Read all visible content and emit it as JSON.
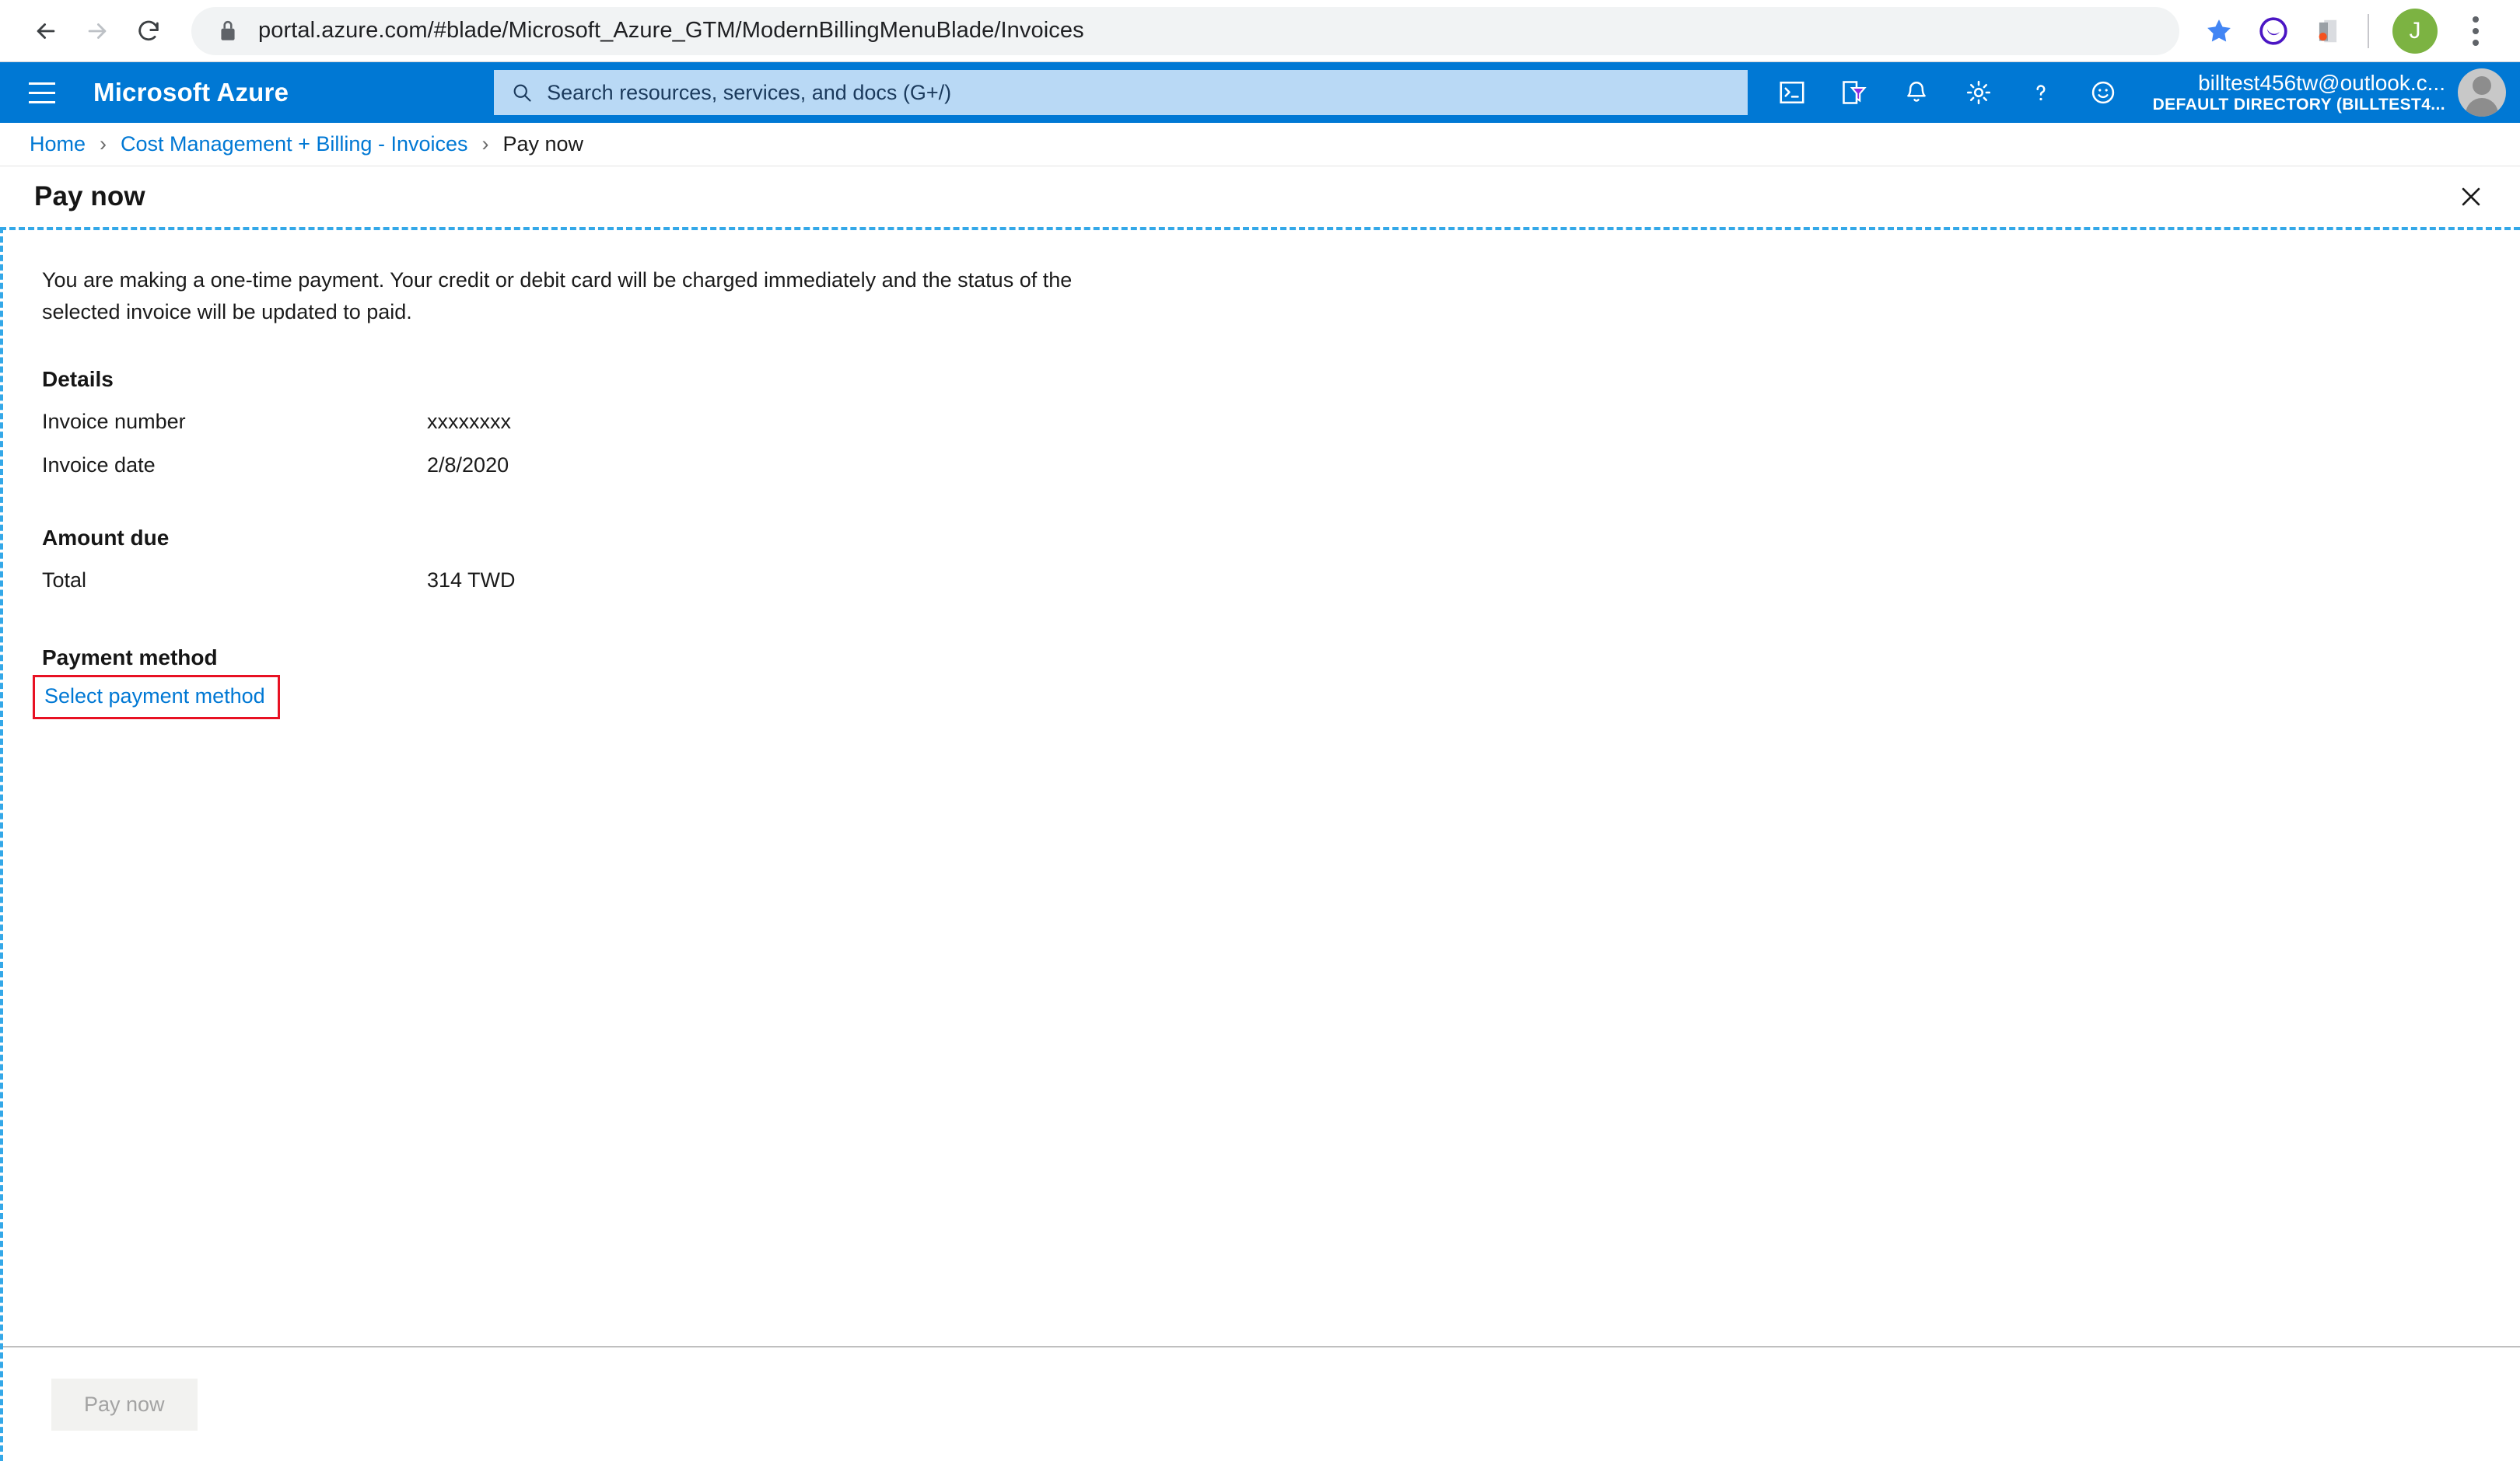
{
  "browser": {
    "back_icon": "back-arrow-icon",
    "forward_icon": "forward-arrow-icon",
    "reload_icon": "reload-icon",
    "lock_icon": "lock-icon",
    "url": "portal.azure.com/#blade/Microsoft_Azure_GTM/ModernBillingMenuBlade/Invoices",
    "bookmark_icon": "star-icon",
    "extension_purple_icon": "purple-circle-extension-icon",
    "extension_doc_icon": "document-extension-icon",
    "profile_initial": "J",
    "menu_icon": "kebab-menu-icon"
  },
  "azure_header": {
    "menu_icon": "hamburger-menu-icon",
    "brand": "Microsoft Azure",
    "search_placeholder": "Search resources, services, and docs (G+/)",
    "search_icon": "search-icon",
    "icons": [
      {
        "name": "cloud-shell-icon",
        "glyph": ">_"
      },
      {
        "name": "directory-filter-icon",
        "glyph": "filter"
      },
      {
        "name": "notifications-bell-icon",
        "glyph": "bell"
      },
      {
        "name": "settings-gear-icon",
        "glyph": "gear"
      },
      {
        "name": "help-icon",
        "glyph": "?"
      },
      {
        "name": "feedback-smiley-icon",
        "glyph": "smiley"
      }
    ],
    "account_name": "billtest456tw@outlook.c...",
    "account_directory": "DEFAULT DIRECTORY (BILLTEST4...",
    "avatar_icon": "user-avatar-icon"
  },
  "breadcrumb": {
    "items": [
      {
        "label": "Home",
        "current": false
      },
      {
        "label": "Cost Management + Billing - Invoices",
        "current": false
      },
      {
        "label": "Pay now",
        "current": true
      }
    ],
    "separator": "›"
  },
  "blade": {
    "title": "Pay now",
    "close_icon": "close-icon",
    "intro": "You are making a one-time payment. Your credit or debit card will be charged immediately and the status of the selected invoice will be updated to paid.",
    "details": {
      "heading": "Details",
      "rows": [
        {
          "label": "Invoice number",
          "value": "xxxxxxxx"
        },
        {
          "label": "Invoice date",
          "value": "2/8/2020"
        }
      ]
    },
    "amount_due": {
      "heading": "Amount due",
      "rows": [
        {
          "label": "Total",
          "value": "314 TWD"
        }
      ]
    },
    "payment_method": {
      "heading": "Payment method",
      "select_link": "Select payment method"
    },
    "footer": {
      "pay_now_label": "Pay now"
    }
  },
  "colors": {
    "azure_blue": "#0078d4",
    "link_blue": "#0078d4",
    "highlight_red": "#e81123",
    "dashed_focus": "#34a8e8",
    "disabled_text": "#a3a3a3"
  }
}
